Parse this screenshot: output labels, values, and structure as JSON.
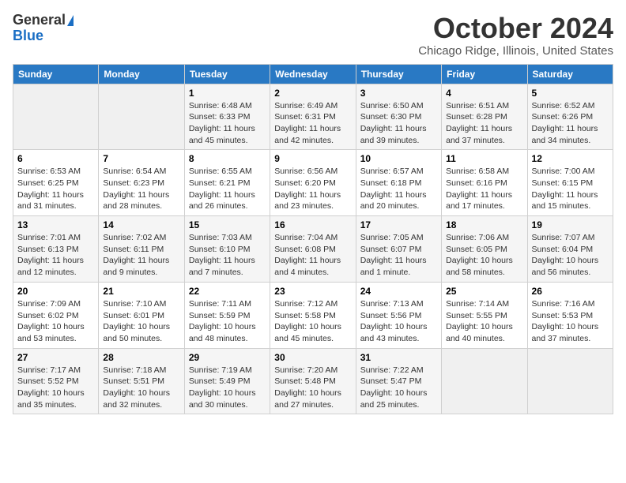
{
  "header": {
    "logo_general": "General",
    "logo_blue": "Blue",
    "month_title": "October 2024",
    "location": "Chicago Ridge, Illinois, United States"
  },
  "days_of_week": [
    "Sunday",
    "Monday",
    "Tuesday",
    "Wednesday",
    "Thursday",
    "Friday",
    "Saturday"
  ],
  "weeks": [
    [
      {
        "day": "",
        "info": ""
      },
      {
        "day": "",
        "info": ""
      },
      {
        "day": "1",
        "info": "Sunrise: 6:48 AM\nSunset: 6:33 PM\nDaylight: 11 hours and 45 minutes."
      },
      {
        "day": "2",
        "info": "Sunrise: 6:49 AM\nSunset: 6:31 PM\nDaylight: 11 hours and 42 minutes."
      },
      {
        "day": "3",
        "info": "Sunrise: 6:50 AM\nSunset: 6:30 PM\nDaylight: 11 hours and 39 minutes."
      },
      {
        "day": "4",
        "info": "Sunrise: 6:51 AM\nSunset: 6:28 PM\nDaylight: 11 hours and 37 minutes."
      },
      {
        "day": "5",
        "info": "Sunrise: 6:52 AM\nSunset: 6:26 PM\nDaylight: 11 hours and 34 minutes."
      }
    ],
    [
      {
        "day": "6",
        "info": "Sunrise: 6:53 AM\nSunset: 6:25 PM\nDaylight: 11 hours and 31 minutes."
      },
      {
        "day": "7",
        "info": "Sunrise: 6:54 AM\nSunset: 6:23 PM\nDaylight: 11 hours and 28 minutes."
      },
      {
        "day": "8",
        "info": "Sunrise: 6:55 AM\nSunset: 6:21 PM\nDaylight: 11 hours and 26 minutes."
      },
      {
        "day": "9",
        "info": "Sunrise: 6:56 AM\nSunset: 6:20 PM\nDaylight: 11 hours and 23 minutes."
      },
      {
        "day": "10",
        "info": "Sunrise: 6:57 AM\nSunset: 6:18 PM\nDaylight: 11 hours and 20 minutes."
      },
      {
        "day": "11",
        "info": "Sunrise: 6:58 AM\nSunset: 6:16 PM\nDaylight: 11 hours and 17 minutes."
      },
      {
        "day": "12",
        "info": "Sunrise: 7:00 AM\nSunset: 6:15 PM\nDaylight: 11 hours and 15 minutes."
      }
    ],
    [
      {
        "day": "13",
        "info": "Sunrise: 7:01 AM\nSunset: 6:13 PM\nDaylight: 11 hours and 12 minutes."
      },
      {
        "day": "14",
        "info": "Sunrise: 7:02 AM\nSunset: 6:11 PM\nDaylight: 11 hours and 9 minutes."
      },
      {
        "day": "15",
        "info": "Sunrise: 7:03 AM\nSunset: 6:10 PM\nDaylight: 11 hours and 7 minutes."
      },
      {
        "day": "16",
        "info": "Sunrise: 7:04 AM\nSunset: 6:08 PM\nDaylight: 11 hours and 4 minutes."
      },
      {
        "day": "17",
        "info": "Sunrise: 7:05 AM\nSunset: 6:07 PM\nDaylight: 11 hours and 1 minute."
      },
      {
        "day": "18",
        "info": "Sunrise: 7:06 AM\nSunset: 6:05 PM\nDaylight: 10 hours and 58 minutes."
      },
      {
        "day": "19",
        "info": "Sunrise: 7:07 AM\nSunset: 6:04 PM\nDaylight: 10 hours and 56 minutes."
      }
    ],
    [
      {
        "day": "20",
        "info": "Sunrise: 7:09 AM\nSunset: 6:02 PM\nDaylight: 10 hours and 53 minutes."
      },
      {
        "day": "21",
        "info": "Sunrise: 7:10 AM\nSunset: 6:01 PM\nDaylight: 10 hours and 50 minutes."
      },
      {
        "day": "22",
        "info": "Sunrise: 7:11 AM\nSunset: 5:59 PM\nDaylight: 10 hours and 48 minutes."
      },
      {
        "day": "23",
        "info": "Sunrise: 7:12 AM\nSunset: 5:58 PM\nDaylight: 10 hours and 45 minutes."
      },
      {
        "day": "24",
        "info": "Sunrise: 7:13 AM\nSunset: 5:56 PM\nDaylight: 10 hours and 43 minutes."
      },
      {
        "day": "25",
        "info": "Sunrise: 7:14 AM\nSunset: 5:55 PM\nDaylight: 10 hours and 40 minutes."
      },
      {
        "day": "26",
        "info": "Sunrise: 7:16 AM\nSunset: 5:53 PM\nDaylight: 10 hours and 37 minutes."
      }
    ],
    [
      {
        "day": "27",
        "info": "Sunrise: 7:17 AM\nSunset: 5:52 PM\nDaylight: 10 hours and 35 minutes."
      },
      {
        "day": "28",
        "info": "Sunrise: 7:18 AM\nSunset: 5:51 PM\nDaylight: 10 hours and 32 minutes."
      },
      {
        "day": "29",
        "info": "Sunrise: 7:19 AM\nSunset: 5:49 PM\nDaylight: 10 hours and 30 minutes."
      },
      {
        "day": "30",
        "info": "Sunrise: 7:20 AM\nSunset: 5:48 PM\nDaylight: 10 hours and 27 minutes."
      },
      {
        "day": "31",
        "info": "Sunrise: 7:22 AM\nSunset: 5:47 PM\nDaylight: 10 hours and 25 minutes."
      },
      {
        "day": "",
        "info": ""
      },
      {
        "day": "",
        "info": ""
      }
    ]
  ]
}
